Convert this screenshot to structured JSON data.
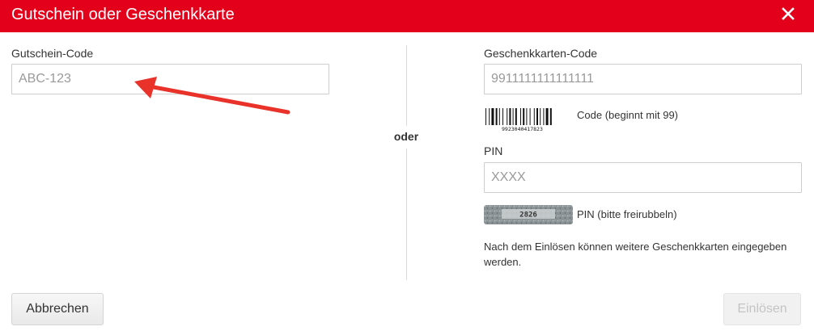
{
  "dialog": {
    "title": "Gutschein oder Geschenkkarte"
  },
  "voucher": {
    "label": "Gutschein-Code",
    "placeholder": "ABC-123"
  },
  "separator": {
    "text": "oder"
  },
  "giftcard": {
    "code_label": "Geschenkkarten-Code",
    "code_placeholder": "9911111111111111",
    "barcode_number": "9923040417823",
    "code_hint": "Code (beginnt mit 99)",
    "pin_label": "PIN",
    "pin_placeholder": "XXXX",
    "scratch_number": "2826",
    "pin_hint": "PIN (bitte freirubbeln)",
    "note": "Nach dem Einlösen können weitere Geschenkkarten eingegeben werden."
  },
  "buttons": {
    "cancel": "Abbrechen",
    "redeem": "Einlösen"
  },
  "colors": {
    "brand": "#e3001b",
    "annotation_arrow": "#e8322a"
  },
  "icons": {
    "close": "close-icon"
  }
}
